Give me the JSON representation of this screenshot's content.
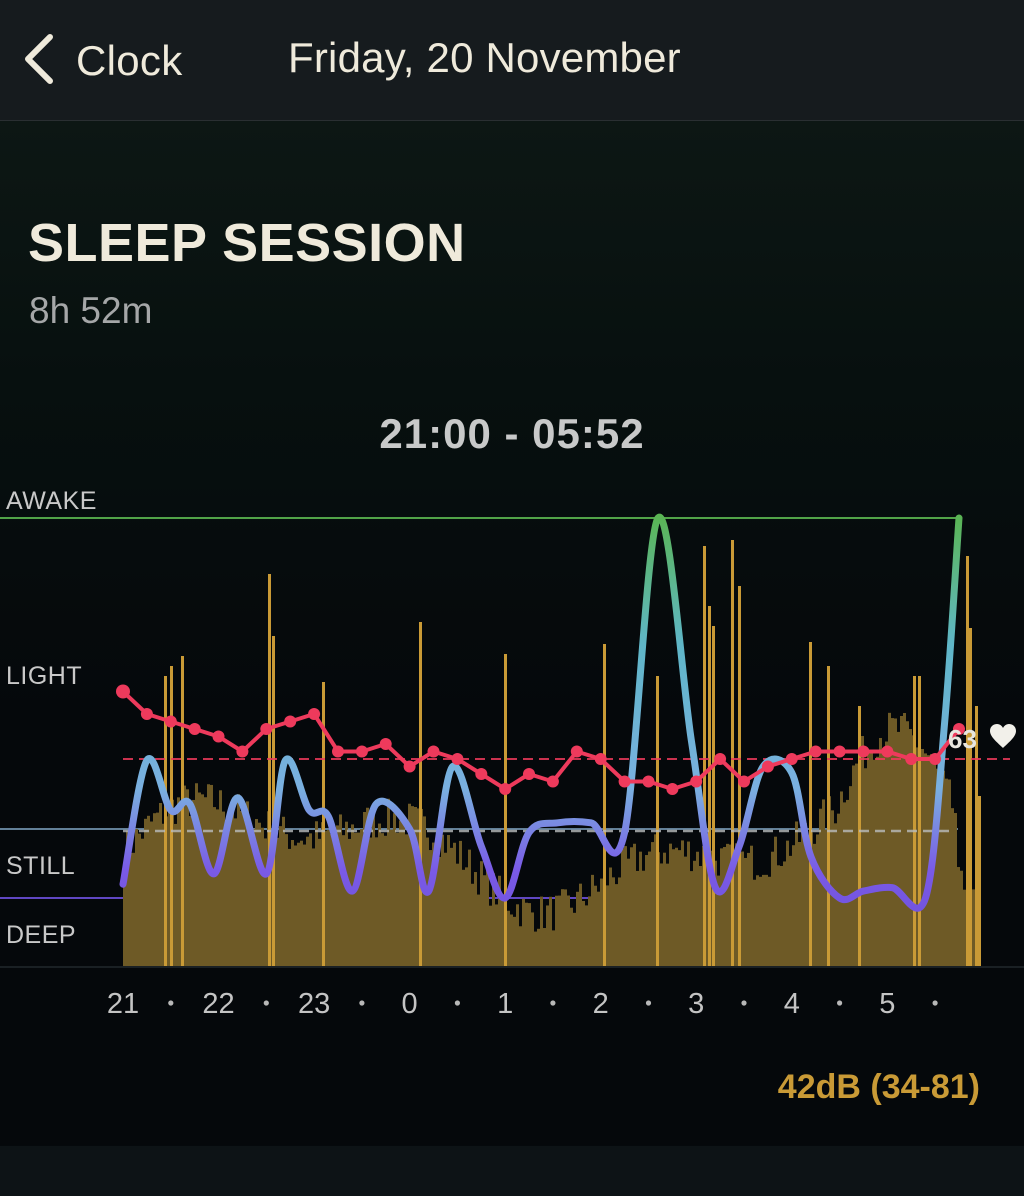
{
  "nav": {
    "back_label": "Clock",
    "title": "Friday, 20 November"
  },
  "session": {
    "title": "SLEEP SESSION",
    "duration": "8h 52m",
    "time_range": "21:00 - 05:52"
  },
  "colors": {
    "awake": "#5ab54f",
    "light": "#7ab0e0",
    "still": "#6e8ea8",
    "deep": "#6a4ed8",
    "heart": "#ee3a5c",
    "noise": "#c99a36",
    "avg_line": "#b9bcbd"
  },
  "chart_data": {
    "type": "line",
    "stage_levels": [
      "AWAKE",
      "LIGHT",
      "STILL",
      "DEEP"
    ],
    "x_ticks": [
      "21",
      "22",
      "23",
      "0",
      "1",
      "2",
      "3",
      "4",
      "5"
    ],
    "x_range": [
      21.0,
      29.97
    ],
    "sleep_stage_curve": {
      "x": [
        21.0,
        21.25,
        21.5,
        21.7,
        21.95,
        22.2,
        22.5,
        22.7,
        22.95,
        23.15,
        23.4,
        23.65,
        24.0,
        24.2,
        24.45,
        24.75,
        25.0,
        25.25,
        25.55,
        25.9,
        26.25,
        26.6,
        26.95,
        27.2,
        27.45,
        27.7,
        28.0,
        28.2,
        28.5,
        28.75,
        29.05,
        29.4,
        29.6,
        29.75
      ],
      "y": [
        0.2,
        1.55,
        1.15,
        1.2,
        0.35,
        1.25,
        0.35,
        1.55,
        1.15,
        1.1,
        0.1,
        1.2,
        1.0,
        0.1,
        1.5,
        0.75,
        0.0,
        0.95,
        1.05,
        1.05,
        0.95,
        3.85,
        1.7,
        0.15,
        0.75,
        1.5,
        1.45,
        0.6,
        0.0,
        0.1,
        0.15,
        0.0,
        1.85,
        3.8
      ]
    },
    "heart_rate": {
      "label": "63",
      "average": 63,
      "x": [
        21.0,
        21.25,
        21.5,
        21.75,
        22.0,
        22.25,
        22.5,
        22.75,
        23.0,
        23.25,
        23.5,
        23.75,
        24.0,
        24.25,
        24.5,
        24.75,
        25.0,
        25.25,
        25.5,
        25.75,
        26.0,
        26.25,
        26.5,
        26.75,
        27.0,
        27.25,
        27.5,
        27.75,
        28.0,
        28.25,
        28.5,
        28.75,
        29.0,
        29.25,
        29.5,
        29.75
      ],
      "y": [
        72,
        69,
        68,
        67,
        66,
        64,
        67,
        68,
        69,
        64,
        64,
        65,
        62,
        64,
        63,
        61,
        59,
        61,
        60,
        64,
        63,
        60,
        60,
        59,
        60,
        63,
        60,
        62,
        63,
        64,
        64,
        64,
        64,
        63,
        63,
        67
      ]
    },
    "noise_db": {
      "label": "42dB (34-81)",
      "average": 42,
      "min": 34,
      "max": 81
    }
  }
}
